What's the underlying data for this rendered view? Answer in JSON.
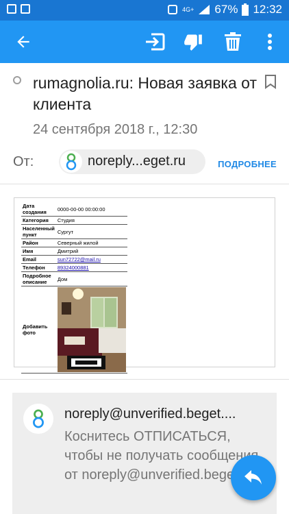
{
  "status_bar": {
    "network": "4G+",
    "battery": "67%",
    "time": "12:32"
  },
  "toolbar": {
    "back": "arrow-left-icon",
    "actions": [
      "move-icon",
      "spam-icon",
      "delete-icon",
      "more-icon"
    ]
  },
  "email": {
    "subject": "rumagnolia.ru: Новая заявка от клиента",
    "date": "24 сентября 2018 г., 12:30",
    "from_label": "От:",
    "sender": "noreply...eget.ru",
    "details_link": "ПОДРОБНЕЕ"
  },
  "order_table": {
    "rows": [
      {
        "key": "Дата создания",
        "value": "0000-00-00 00:00:00"
      },
      {
        "key": "Категория",
        "value": "Студия"
      },
      {
        "key": "Населенный пункт",
        "value": "Сургут"
      },
      {
        "key": "Район",
        "value": "Северный жилой"
      },
      {
        "key": "Имя",
        "value": "Дмитрий"
      },
      {
        "key": "Email",
        "value": "sun72722@mail.ru"
      },
      {
        "key": "Телефон",
        "value": "89324000881"
      },
      {
        "key": "Подробное описание",
        "value": "Дом"
      },
      {
        "key": "Добавить фото",
        "value": ""
      }
    ]
  },
  "unsubscribe_card": {
    "from": "noreply@unverified.beget....",
    "message": "Коснитесь ОТПИСАТЬСЯ, чтобы не получать сообщения от noreply@unverified.beget.ru"
  },
  "fab": {
    "icon": "reply-icon"
  }
}
